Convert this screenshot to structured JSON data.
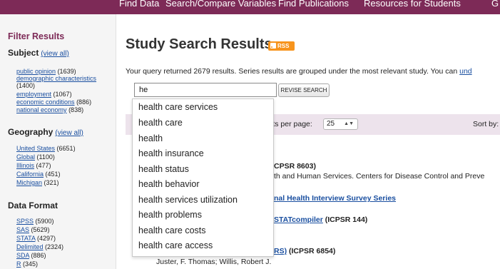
{
  "nav": {
    "items": [
      "Find Data",
      "Search/Compare Variables",
      "Find Publications",
      "Resources for Students",
      "G"
    ]
  },
  "sidebar": {
    "title": "Filter Results",
    "view_all": "(view all)",
    "sections": [
      {
        "heading": "Subject",
        "items": [
          {
            "label": "public opinion",
            "count": "(1639)"
          },
          {
            "label": "demographic characteristics",
            "count": "(1400)"
          },
          {
            "label": "employment",
            "count": "(1067)"
          },
          {
            "label": "economic conditions",
            "count": "(886)"
          },
          {
            "label": "national economy",
            "count": "(838)"
          }
        ]
      },
      {
        "heading": "Geography",
        "items": [
          {
            "label": "United States",
            "count": "(6651)"
          },
          {
            "label": "Global",
            "count": "(1100)"
          },
          {
            "label": "Illinois",
            "count": "(477)"
          },
          {
            "label": "California",
            "count": "(451)"
          },
          {
            "label": "Michigan",
            "count": "(321)"
          }
        ]
      },
      {
        "heading": "Data Format",
        "items": [
          {
            "label": "SPSS",
            "count": "(5900)"
          },
          {
            "label": "SAS",
            "count": "(5629)"
          },
          {
            "label": "STATA",
            "count": "(4297)"
          },
          {
            "label": "Delimited",
            "count": "(2324)"
          },
          {
            "label": "SDA",
            "count": "(886)"
          },
          {
            "label": "R",
            "count": "(345)"
          }
        ]
      }
    ]
  },
  "main": {
    "title": "Study Search Results",
    "rss_label": "RSS",
    "summary": "Your query returned 2679 results. Series results are grouped under the most relevant study. You can ",
    "summary_link": "und",
    "search": {
      "value": "he",
      "button": "REVISE SEARCH"
    },
    "results_bar": {
      "per_page_label": "lts per page:",
      "per_page_value": "25",
      "sort_label": "Sort by:"
    },
    "result_lines": [
      "CPSR 8603)",
      "th and Human Services. Centers for Disease Control and Preve",
      "nal Health Interview Survey Series",
      "STATcompiler",
      "(ICPSR 144)",
      "RS)",
      "(ICPSR 6854)",
      "Juster, F. Thomas; Willis, Robert J."
    ]
  },
  "autocomplete": {
    "items": [
      "health care services",
      "health care",
      "health",
      "health insurance",
      "health status",
      "health behavior",
      "health services utilization",
      "health problems",
      "health care costs",
      "health care access"
    ]
  },
  "colors": {
    "nav_bg": "#7d2a57",
    "link": "#1a4fa0",
    "sidebar_title": "#7d2a57",
    "rss": "#f7941d",
    "results_bar": "#ede3ec"
  }
}
